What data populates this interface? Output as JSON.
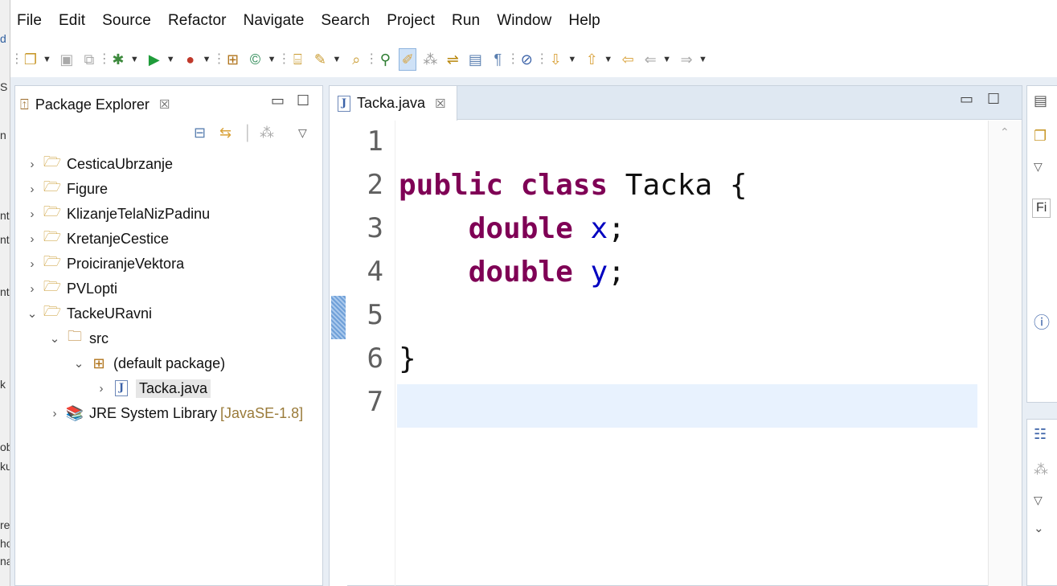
{
  "menu": [
    "File",
    "Edit",
    "Source",
    "Refactor",
    "Navigate",
    "Search",
    "Project",
    "Run",
    "Window",
    "Help"
  ],
  "toolbar_icons": [
    "new-wizard-icon",
    "save-icon",
    "save-all-icon",
    "debug-icon",
    "run-icon",
    "run-external-tools-icon",
    "new-java-package-icon",
    "new-java-class-icon",
    "open-type-icon",
    "open-task-icon",
    "search-icon",
    "toggle-mark-occurrences-icon",
    "toggle-highlight-icon",
    "toggle-block-selection-icon",
    "toggle-word-wrap-icon",
    "show-whitespace-icon",
    "skip-breakpoints-icon",
    "next-annotation-icon",
    "previous-annotation-icon",
    "last-edit-location-icon",
    "back-icon",
    "forward-icon"
  ],
  "package_explorer": {
    "title": "Package Explorer",
    "tree": [
      {
        "label": "CesticaUbrzanje",
        "icon": "java-project-icon",
        "expanded": false
      },
      {
        "label": "Figure",
        "icon": "java-project-icon",
        "expanded": false
      },
      {
        "label": "KlizanjeTelaNizPadinu",
        "icon": "java-project-icon",
        "expanded": false
      },
      {
        "label": "KretanjeCestice",
        "icon": "java-project-icon",
        "expanded": false
      },
      {
        "label": "ProiciranjeVektora",
        "icon": "java-project-icon",
        "expanded": false
      },
      {
        "label": "PVLopti",
        "icon": "java-project-icon",
        "expanded": false
      },
      {
        "label": "TackeURavni",
        "icon": "java-project-icon",
        "expanded": true
      },
      {
        "label": "src",
        "icon": "source-folder-icon",
        "expanded": true
      },
      {
        "label": "(default package)",
        "icon": "package-icon",
        "expanded": true
      },
      {
        "label": "Tacka.java",
        "icon": "java-file-icon",
        "expanded": false,
        "selected": true
      },
      {
        "label": "JRE System Library",
        "decoration": "[JavaSE-1.8]",
        "icon": "library-icon",
        "expanded": false
      }
    ]
  },
  "editor": {
    "tab_label": "Tacka.java",
    "file_icon_letter": "J",
    "line_numbers": [
      "1",
      "2",
      "3",
      "4",
      "5",
      "6",
      "7"
    ],
    "current_line": 7,
    "code": {
      "line2_kw1": "public",
      "line2_kw2": "class",
      "line2_rest": " Tacka {",
      "line3_kw": "double",
      "line3_field": "x",
      "line3_end": ";",
      "line4_kw": "double",
      "line4_field": "y",
      "line4_end": ";",
      "line6": "}"
    }
  },
  "right_panel": {
    "filter_text": "Fi"
  },
  "colors": {
    "keyword": "#7f0055",
    "field": "#0000c0",
    "current_line_bg": "#e8f2fe",
    "workbench_bg": "#e8eef5"
  }
}
